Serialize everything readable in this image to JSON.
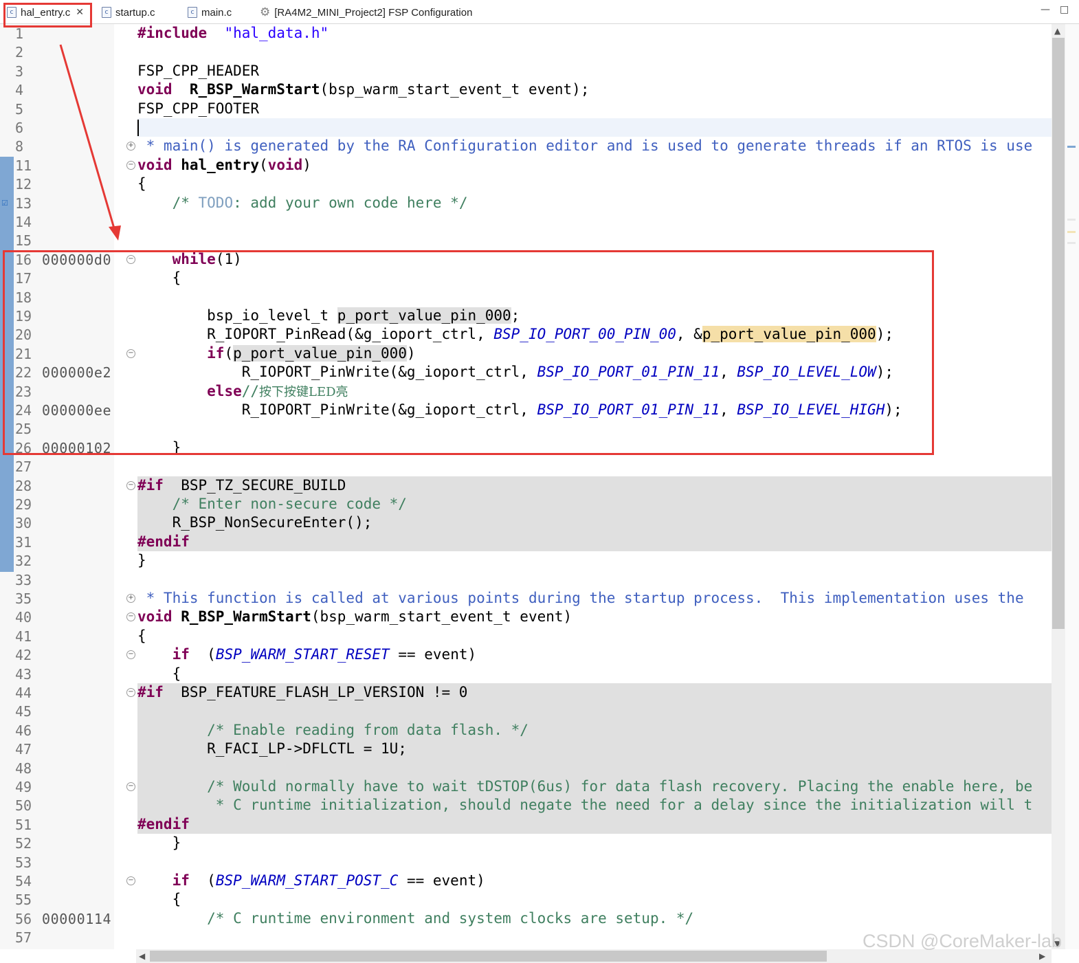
{
  "tabs": [
    {
      "label": "hal_entry.c",
      "icon": "c-file-icon",
      "active": true
    },
    {
      "label": "startup.c",
      "icon": "c-file-icon"
    },
    {
      "label": "main.c",
      "icon": "c-file-icon"
    },
    {
      "label": "[RA4M2_MINI_Project2] FSP Configuration",
      "icon": "gear-icon"
    }
  ],
  "window_controls": {
    "minimize": "—",
    "maximize": "□"
  },
  "colors": {
    "keyword": "#7f0055",
    "string": "#2a00ff",
    "comment": "#3f7f5f",
    "macro": "#0000c0",
    "annotation": "#e53935",
    "change_bar": "#7fa7d3",
    "inactive_code_bg": "#e0e0e0"
  },
  "lines": [
    {
      "n": "1",
      "addr": "",
      "fold": "",
      "code": [
        [
          "pp",
          "#include"
        ],
        [
          "",
          "  "
        ],
        [
          "str",
          "\"hal_data.h\""
        ]
      ]
    },
    {
      "n": "2",
      "addr": "",
      "fold": "",
      "code": []
    },
    {
      "n": "3",
      "addr": "",
      "fold": "",
      "code": [
        [
          "",
          "FSP_CPP_HEADER"
        ]
      ]
    },
    {
      "n": "4",
      "addr": "",
      "fold": "",
      "code": [
        [
          "kw",
          "void"
        ],
        [
          "",
          "  "
        ],
        [
          "fn",
          "R_BSP_WarmStart"
        ],
        [
          "",
          "(bsp_warm_start_event_t event);"
        ]
      ]
    },
    {
      "n": "5",
      "addr": "",
      "fold": "",
      "code": [
        [
          "",
          "FSP_CPP_FOOTER"
        ]
      ]
    },
    {
      "n": "6",
      "addr": "",
      "fold": "",
      "code": [],
      "current": true
    },
    {
      "n": "8",
      "addr": "",
      "fold": "+",
      "code": [
        [
          "doc",
          " * main() is generated by the RA Configuration editor and is used to generate threads if an RTOS is use"
        ]
      ]
    },
    {
      "n": "11",
      "addr": "",
      "fold": "-",
      "code": [
        [
          "kw",
          "void"
        ],
        [
          "",
          ""
        ],
        [
          "fn",
          " hal_entry"
        ],
        [
          "",
          "("
        ],
        [
          "kw",
          "void"
        ],
        [
          "",
          ")"
        ]
      ]
    },
    {
      "n": "12",
      "addr": "",
      "fold": "",
      "code": [
        [
          "",
          "{"
        ]
      ]
    },
    {
      "n": "13",
      "addr": "",
      "fold": "",
      "code": [
        [
          "cm",
          "    /* "
        ],
        [
          "todo",
          "TODO"
        ],
        [
          "cm",
          ": add your own code here */"
        ]
      ],
      "task": true
    },
    {
      "n": "14",
      "addr": "",
      "fold": "",
      "code": []
    },
    {
      "n": "15",
      "addr": "",
      "fold": "",
      "code": []
    },
    {
      "n": "16",
      "addr": "000000d0",
      "fold": "-",
      "code": [
        [
          "",
          "    "
        ],
        [
          "kw",
          "while"
        ],
        [
          "",
          "(1)"
        ]
      ]
    },
    {
      "n": "17",
      "addr": "",
      "fold": "",
      "code": [
        [
          "",
          "    {"
        ]
      ]
    },
    {
      "n": "18",
      "addr": "",
      "fold": "",
      "code": []
    },
    {
      "n": "19",
      "addr": "",
      "fold": "",
      "code": [
        [
          "",
          "        bsp_io_level_t "
        ],
        [
          "occ",
          "p_port_value_pin_000"
        ],
        [
          "",
          ";"
        ]
      ]
    },
    {
      "n": "20",
      "addr": "",
      "fold": "",
      "code": [
        [
          "",
          "        R_IOPORT_PinRead(&g_ioport_ctrl, "
        ],
        [
          "mac",
          "BSP_IO_PORT_00_PIN_00"
        ],
        [
          "",
          ", &"
        ],
        [
          "occw",
          "p_port_value_pin_000"
        ],
        [
          "",
          ");"
        ]
      ]
    },
    {
      "n": "21",
      "addr": "",
      "fold": "-",
      "code": [
        [
          "",
          "        "
        ],
        [
          "kw",
          "if"
        ],
        [
          "",
          "("
        ],
        [
          "occ",
          "p_port_value_pin_000"
        ],
        [
          "",
          ")"
        ]
      ]
    },
    {
      "n": "22",
      "addr": "000000e2",
      "fold": "",
      "code": [
        [
          "",
          "            R_IOPORT_PinWrite(&g_ioport_ctrl, "
        ],
        [
          "mac",
          "BSP_IO_PORT_01_PIN_11"
        ],
        [
          "",
          ", "
        ],
        [
          "mac",
          "BSP_IO_LEVEL_LOW"
        ],
        [
          "",
          ");"
        ]
      ]
    },
    {
      "n": "23",
      "addr": "",
      "fold": "",
      "code": [
        [
          "",
          "        "
        ],
        [
          "kw",
          "else"
        ],
        [
          "cm",
          "//"
        ],
        [
          "cmcjk",
          "按下按键LED亮"
        ]
      ]
    },
    {
      "n": "24",
      "addr": "000000ee",
      "fold": "",
      "code": [
        [
          "",
          "            R_IOPORT_PinWrite(&g_ioport_ctrl, "
        ],
        [
          "mac",
          "BSP_IO_PORT_01_PIN_11"
        ],
        [
          "",
          ", "
        ],
        [
          "mac",
          "BSP_IO_LEVEL_HIGH"
        ],
        [
          "",
          ");"
        ]
      ]
    },
    {
      "n": "25",
      "addr": "",
      "fold": "",
      "code": []
    },
    {
      "n": "26",
      "addr": "00000102",
      "fold": "",
      "code": [
        [
          "",
          "    }"
        ]
      ]
    },
    {
      "n": "27",
      "addr": "",
      "fold": "",
      "code": []
    },
    {
      "n": "28",
      "addr": "",
      "fold": "-",
      "code": [
        [
          "pp",
          "#if"
        ],
        [
          "",
          ""
        ],
        [
          "",
          "  BSP_TZ_SECURE_BUILD"
        ]
      ],
      "inactive": true
    },
    {
      "n": "29",
      "addr": "",
      "fold": "",
      "code": [
        [
          "cm",
          "    /* Enter non-secure code */"
        ]
      ],
      "inactive": true
    },
    {
      "n": "30",
      "addr": "",
      "fold": "",
      "code": [
        [
          "",
          "    R_BSP_NonSecureEnter();"
        ]
      ],
      "inactive": true
    },
    {
      "n": "31",
      "addr": "",
      "fold": "",
      "code": [
        [
          "pp",
          "#endif"
        ]
      ],
      "inactive": true
    },
    {
      "n": "32",
      "addr": "",
      "fold": "",
      "code": [
        [
          "",
          "}"
        ]
      ]
    },
    {
      "n": "33",
      "addr": "",
      "fold": "",
      "code": []
    },
    {
      "n": "35",
      "addr": "",
      "fold": "+",
      "code": [
        [
          "doc",
          " * This function is called at various points during the startup process.  This implementation uses the"
        ]
      ]
    },
    {
      "n": "40",
      "addr": "",
      "fold": "-",
      "code": [
        [
          "kw",
          "void"
        ],
        [
          "",
          ""
        ],
        [
          "fn",
          " R_BSP_WarmStart"
        ],
        [
          "",
          "(bsp_warm_start_event_t event)"
        ]
      ]
    },
    {
      "n": "41",
      "addr": "",
      "fold": "",
      "code": [
        [
          "",
          "{"
        ]
      ]
    },
    {
      "n": "42",
      "addr": "",
      "fold": "-",
      "code": [
        [
          "",
          "    "
        ],
        [
          "kw",
          "if"
        ],
        [
          "",
          "  ("
        ],
        [
          "mac",
          "BSP_WARM_START_RESET"
        ],
        [
          "",
          ""
        ],
        [
          "",
          " == event)"
        ]
      ]
    },
    {
      "n": "43",
      "addr": "",
      "fold": "",
      "code": [
        [
          "",
          "    {"
        ]
      ]
    },
    {
      "n": "44",
      "addr": "",
      "fold": "-",
      "code": [
        [
          "pp",
          "#if"
        ],
        [
          "",
          ""
        ],
        [
          "",
          "  BSP_FEATURE_FLASH_LP_VERSION != 0"
        ]
      ],
      "inactive": true
    },
    {
      "n": "45",
      "addr": "",
      "fold": "",
      "code": [],
      "inactive": true
    },
    {
      "n": "46",
      "addr": "",
      "fold": "",
      "code": [
        [
          "cm",
          "        /* Enable reading from data flash. */"
        ]
      ],
      "inactive": true
    },
    {
      "n": "47",
      "addr": "",
      "fold": "",
      "code": [
        [
          "",
          "        R_FACI_LP->DFLCTL = 1U;"
        ]
      ],
      "inactive": true
    },
    {
      "n": "48",
      "addr": "",
      "fold": "",
      "code": [],
      "inactive": true
    },
    {
      "n": "49",
      "addr": "",
      "fold": "-",
      "code": [
        [
          "cm",
          "        /* Would normally have to wait tDSTOP(6us) for data flash recovery. Placing the enable here, be"
        ]
      ],
      "inactive": true
    },
    {
      "n": "50",
      "addr": "",
      "fold": "",
      "code": [
        [
          "cm",
          "         * C runtime initialization, should negate the need for a delay since the initialization will t"
        ]
      ],
      "inactive": true
    },
    {
      "n": "51",
      "addr": "",
      "fold": "",
      "code": [
        [
          "pp",
          "#endif"
        ]
      ],
      "inactive": true
    },
    {
      "n": "52",
      "addr": "",
      "fold": "",
      "code": [
        [
          "",
          "    }"
        ]
      ]
    },
    {
      "n": "53",
      "addr": "",
      "fold": "",
      "code": []
    },
    {
      "n": "54",
      "addr": "",
      "fold": "-",
      "code": [
        [
          "",
          "    "
        ],
        [
          "kw",
          "if"
        ],
        [
          "",
          "  ("
        ],
        [
          "mac",
          "BSP_WARM_START_POST_C"
        ],
        [
          "",
          " == event)"
        ]
      ]
    },
    {
      "n": "55",
      "addr": "",
      "fold": "",
      "code": [
        [
          "",
          "    {"
        ]
      ]
    },
    {
      "n": "56",
      "addr": "00000114",
      "fold": "",
      "code": [
        [
          "cm",
          "        /* C runtime environment and system clocks are setup. */"
        ]
      ]
    },
    {
      "n": "57",
      "addr": "",
      "fold": "",
      "code": []
    }
  ],
  "scrollbars": {
    "up": "▲",
    "down": "▼",
    "left": "◀",
    "right": "▶"
  },
  "watermark": "CSDN @CoreMaker-lab"
}
